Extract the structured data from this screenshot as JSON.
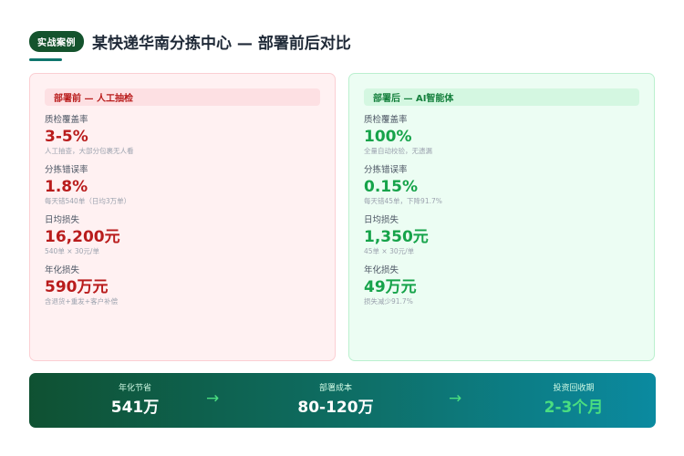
{
  "header": {
    "badge": "实战案例",
    "title": "某快递华南分拣中心 — 部署前后对比"
  },
  "before": {
    "heading": "部署前 — 人工抽检",
    "metrics": [
      {
        "label": "质检覆盖率",
        "value": "3-5%",
        "note": "人工抽查，大部分包裹无人看"
      },
      {
        "label": "分拣错误率",
        "value": "1.8%",
        "note": "每天错540单（日均3万单）"
      },
      {
        "label": "日均损失",
        "value": "16,200元",
        "note": "540单 × 30元/单"
      },
      {
        "label": "年化损失",
        "value": "590万元",
        "note": "含退货+重发+客户补偿"
      }
    ]
  },
  "after": {
    "heading": "部署后 — AI智能体",
    "metrics": [
      {
        "label": "质检覆盖率",
        "value": "100%",
        "note": "全量自动校验，无遗漏"
      },
      {
        "label": "分拣错误率",
        "value": "0.15%",
        "note": "每天错45单，下降91.7%"
      },
      {
        "label": "日均损失",
        "value": "1,350元",
        "note": "45单 × 30元/单"
      },
      {
        "label": "年化损失",
        "value": "49万元",
        "note": "损失减少91.7%"
      }
    ]
  },
  "summary": {
    "items": [
      {
        "label": "年化节省",
        "value": "541万"
      },
      {
        "label": "部署成本",
        "value": "80-120万"
      },
      {
        "label": "投资回收期",
        "value": "2-3个月"
      }
    ],
    "arrow": "→"
  },
  "colors": {
    "before_accent": "#b91c1c",
    "after_accent": "#16a34a",
    "badge_bg": "#14532d",
    "summary_gradient_start": "#0f5132",
    "summary_gradient_end": "#0b8aa0"
  }
}
